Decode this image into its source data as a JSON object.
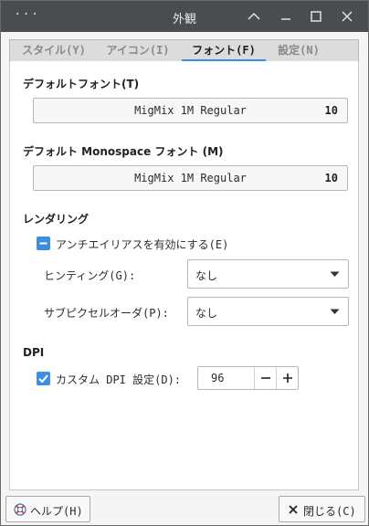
{
  "titlebar": {
    "menu_glyph": "···",
    "title": "外観"
  },
  "tabs": [
    {
      "label": "スタイル(Y)",
      "active": false
    },
    {
      "label": "アイコン(I)",
      "active": false
    },
    {
      "label": "フォント(F)",
      "active": true
    },
    {
      "label": "設定(N)",
      "active": false
    }
  ],
  "default_font": {
    "heading": "デフォルトフォント(T)",
    "font_name": "MigMix 1M Regular",
    "font_size": "10"
  },
  "monospace_font": {
    "heading": "デフォルト Monospace フォント (M)",
    "font_name": "MigMix 1M Regular",
    "font_size": "10"
  },
  "rendering": {
    "heading": "レンダリング",
    "antialias_label": "アンチエイリアスを有効にする(E)",
    "antialias_state": "mixed",
    "hinting_label": "ヒンティング(G):",
    "hinting_value": "なし",
    "subpixel_label": "サブピクセルオーダ(P):",
    "subpixel_value": "なし"
  },
  "dpi": {
    "heading": "DPI",
    "custom_label": "カスタム DPI 設定(D):",
    "custom_checked": true,
    "value": "96"
  },
  "footer": {
    "help_label": "ヘルプ(H)",
    "close_label": "閉じる(C)"
  },
  "colors": {
    "accent": "#3d8ee3",
    "titlebar": "#4a4d50"
  }
}
